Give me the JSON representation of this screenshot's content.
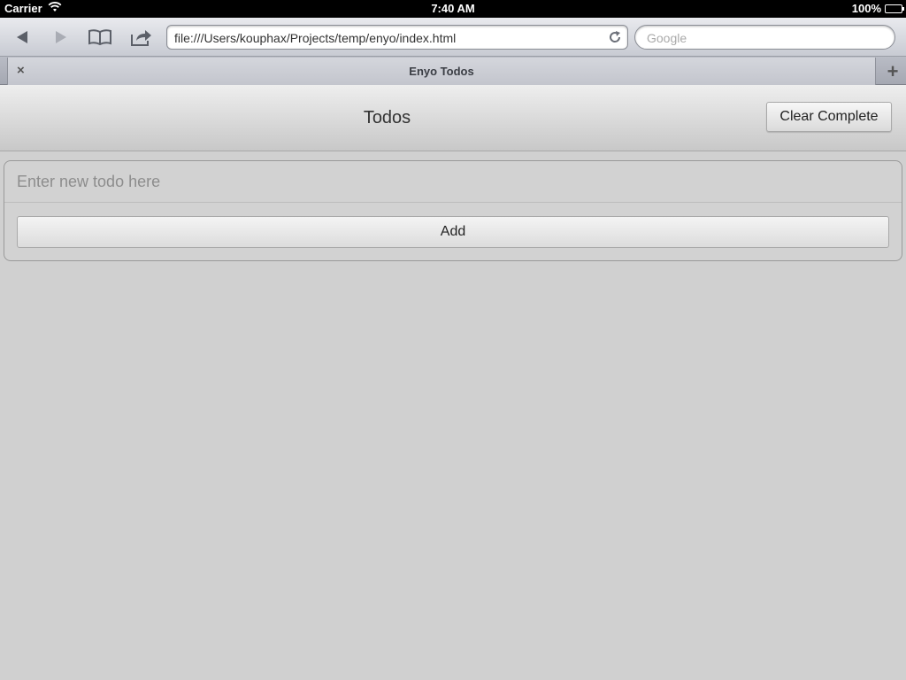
{
  "status_bar": {
    "carrier": "Carrier",
    "time": "7:40 AM",
    "battery": "100%"
  },
  "browser": {
    "url": "file:///Users/kouphax/Projects/temp/enyo/index.html",
    "search_placeholder": "Google",
    "tab_title": "Enyo Todos",
    "tab_close_glyph": "×",
    "new_tab_glyph": "+"
  },
  "app": {
    "title": "Todos",
    "clear_label": "Clear Complete",
    "input_placeholder": "Enter new todo here",
    "add_label": "Add"
  },
  "icons": {
    "back": "back-arrow-icon",
    "forward": "forward-arrow-icon",
    "bookmarks": "bookmarks-book-icon",
    "share": "share-icon",
    "reload": "reload-icon",
    "wifi": "wifi-icon",
    "battery": "battery-icon"
  }
}
